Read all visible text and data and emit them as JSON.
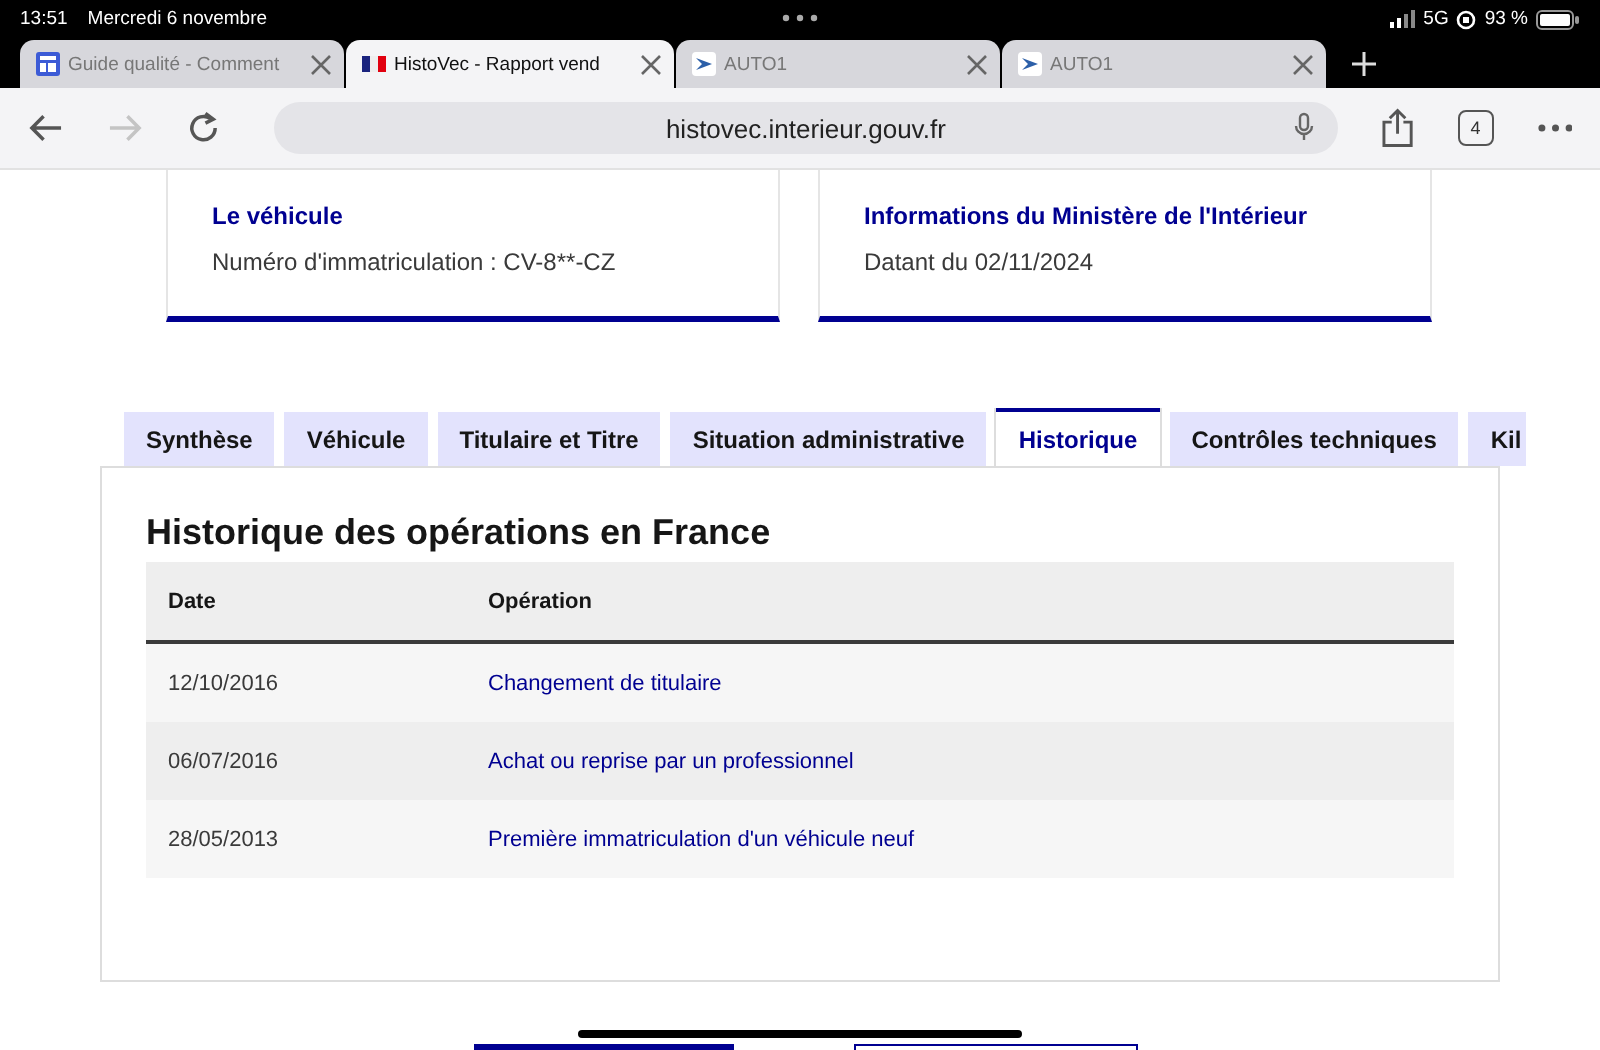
{
  "status_bar": {
    "time": "13:51",
    "date": "Mercredi 6 novembre",
    "network": "5G",
    "battery": "93 %"
  },
  "browser_tabs": [
    {
      "title": "Guide qualité - Comment",
      "kind": "doc",
      "selected": false
    },
    {
      "title": "HistoVec - Rapport vend",
      "kind": "flag",
      "selected": true
    },
    {
      "title": "AUTO1",
      "kind": "auto",
      "selected": false
    },
    {
      "title": "AUTO1",
      "kind": "auto",
      "selected": false
    }
  ],
  "toolbar": {
    "url": "histovec.interieur.gouv.fr",
    "tab_count": "4",
    "forward_disabled": true
  },
  "cards": [
    {
      "title": "Le véhicule",
      "text": "Numéro d'immatriculation : CV-8**-CZ"
    },
    {
      "title": "Informations du Ministère de l'Intérieur",
      "text": "Datant du 02/11/2024"
    }
  ],
  "page_tabs": [
    {
      "label": "Synthèse",
      "selected": false
    },
    {
      "label": "Véhicule",
      "selected": false
    },
    {
      "label": "Titulaire et Titre",
      "selected": false
    },
    {
      "label": "Situation administrative",
      "selected": false
    },
    {
      "label": "Historique",
      "selected": true
    },
    {
      "label": "Contrôles techniques",
      "selected": false
    },
    {
      "label": "Kil",
      "selected": false
    }
  ],
  "panel": {
    "title": "Historique des opérations en France",
    "table": {
      "columns": [
        "Date",
        "Opération"
      ],
      "rows": [
        [
          "12/10/2016",
          "Changement de titulaire"
        ],
        [
          "06/07/2016",
          "Achat ou reprise par un professionnel"
        ],
        [
          "28/05/2013",
          "Première immatriculation d'un véhicule neuf"
        ]
      ]
    }
  }
}
